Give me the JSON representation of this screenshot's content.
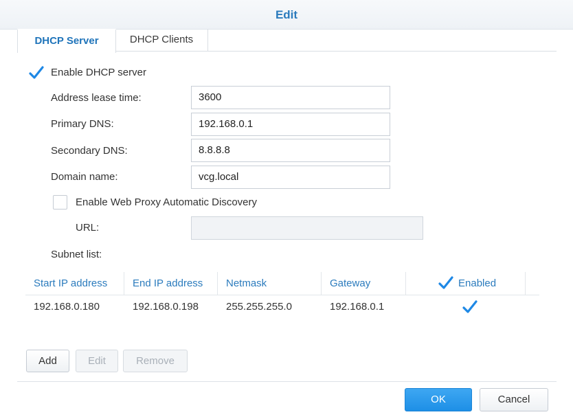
{
  "dialog": {
    "title": "Edit"
  },
  "tabs": [
    {
      "label": "DHCP Server",
      "active": true
    },
    {
      "label": "DHCP Clients",
      "active": false
    }
  ],
  "form": {
    "enable_dhcp": {
      "label": "Enable DHCP server",
      "checked": true
    },
    "lease_time": {
      "label": "Address lease time:",
      "value": "3600"
    },
    "primary_dns": {
      "label": "Primary DNS:",
      "value": "192.168.0.1"
    },
    "secondary_dns": {
      "label": "Secondary DNS:",
      "value": "8.8.8.8"
    },
    "domain_name": {
      "label": "Domain name:",
      "value": "vcg.local"
    },
    "web_proxy": {
      "label": "Enable Web Proxy Automatic Discovery",
      "checked": false
    },
    "url": {
      "label": "URL:",
      "value": ""
    },
    "subnet_list_label": "Subnet list:"
  },
  "subnet_table": {
    "columns": {
      "start_ip": "Start IP address",
      "end_ip": "End IP address",
      "netmask": "Netmask",
      "gateway": "Gateway",
      "enabled": "Enabled"
    },
    "header_checked": true,
    "rows": [
      {
        "start_ip": "192.168.0.180",
        "end_ip": "192.168.0.198",
        "netmask": "255.255.255.0",
        "gateway": "192.168.0.1",
        "enabled": true
      }
    ]
  },
  "actions": {
    "add": "Add",
    "edit": "Edit",
    "remove": "Remove"
  },
  "footer": {
    "ok": "OK",
    "cancel": "Cancel"
  },
  "colors": {
    "accent": "#2b7bbd",
    "primary_button": "#2196e8",
    "checkmark": "#1e88e5"
  }
}
